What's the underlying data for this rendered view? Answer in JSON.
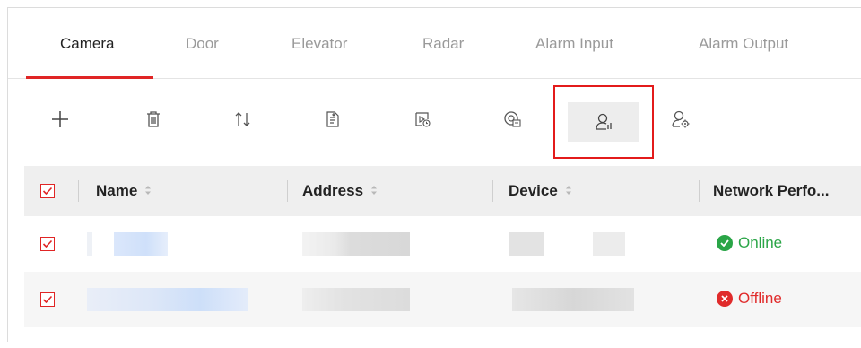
{
  "tabs": [
    {
      "label": "Camera",
      "active": true
    },
    {
      "label": "Door"
    },
    {
      "label": "Elevator"
    },
    {
      "label": "Radar"
    },
    {
      "label": "Alarm Input"
    },
    {
      "label": "Alarm Output"
    }
  ],
  "toolbar": {
    "buttons": [
      "add-icon",
      "delete-icon",
      "sort-icon",
      "import-icon",
      "playback-icon",
      "channel-icon",
      "user-settings-icon",
      "user-config-icon"
    ]
  },
  "table": {
    "columns": [
      "Name",
      "Address",
      "Device",
      "Network Perfo..."
    ],
    "rows": [
      {
        "checked": true,
        "status": "Online",
        "status_color": "#2aa547"
      },
      {
        "checked": true,
        "status": "Offline",
        "status_color": "#e02b2b"
      }
    ]
  },
  "colors": {
    "accent": "#e02525",
    "checkbox": "#e02525"
  }
}
